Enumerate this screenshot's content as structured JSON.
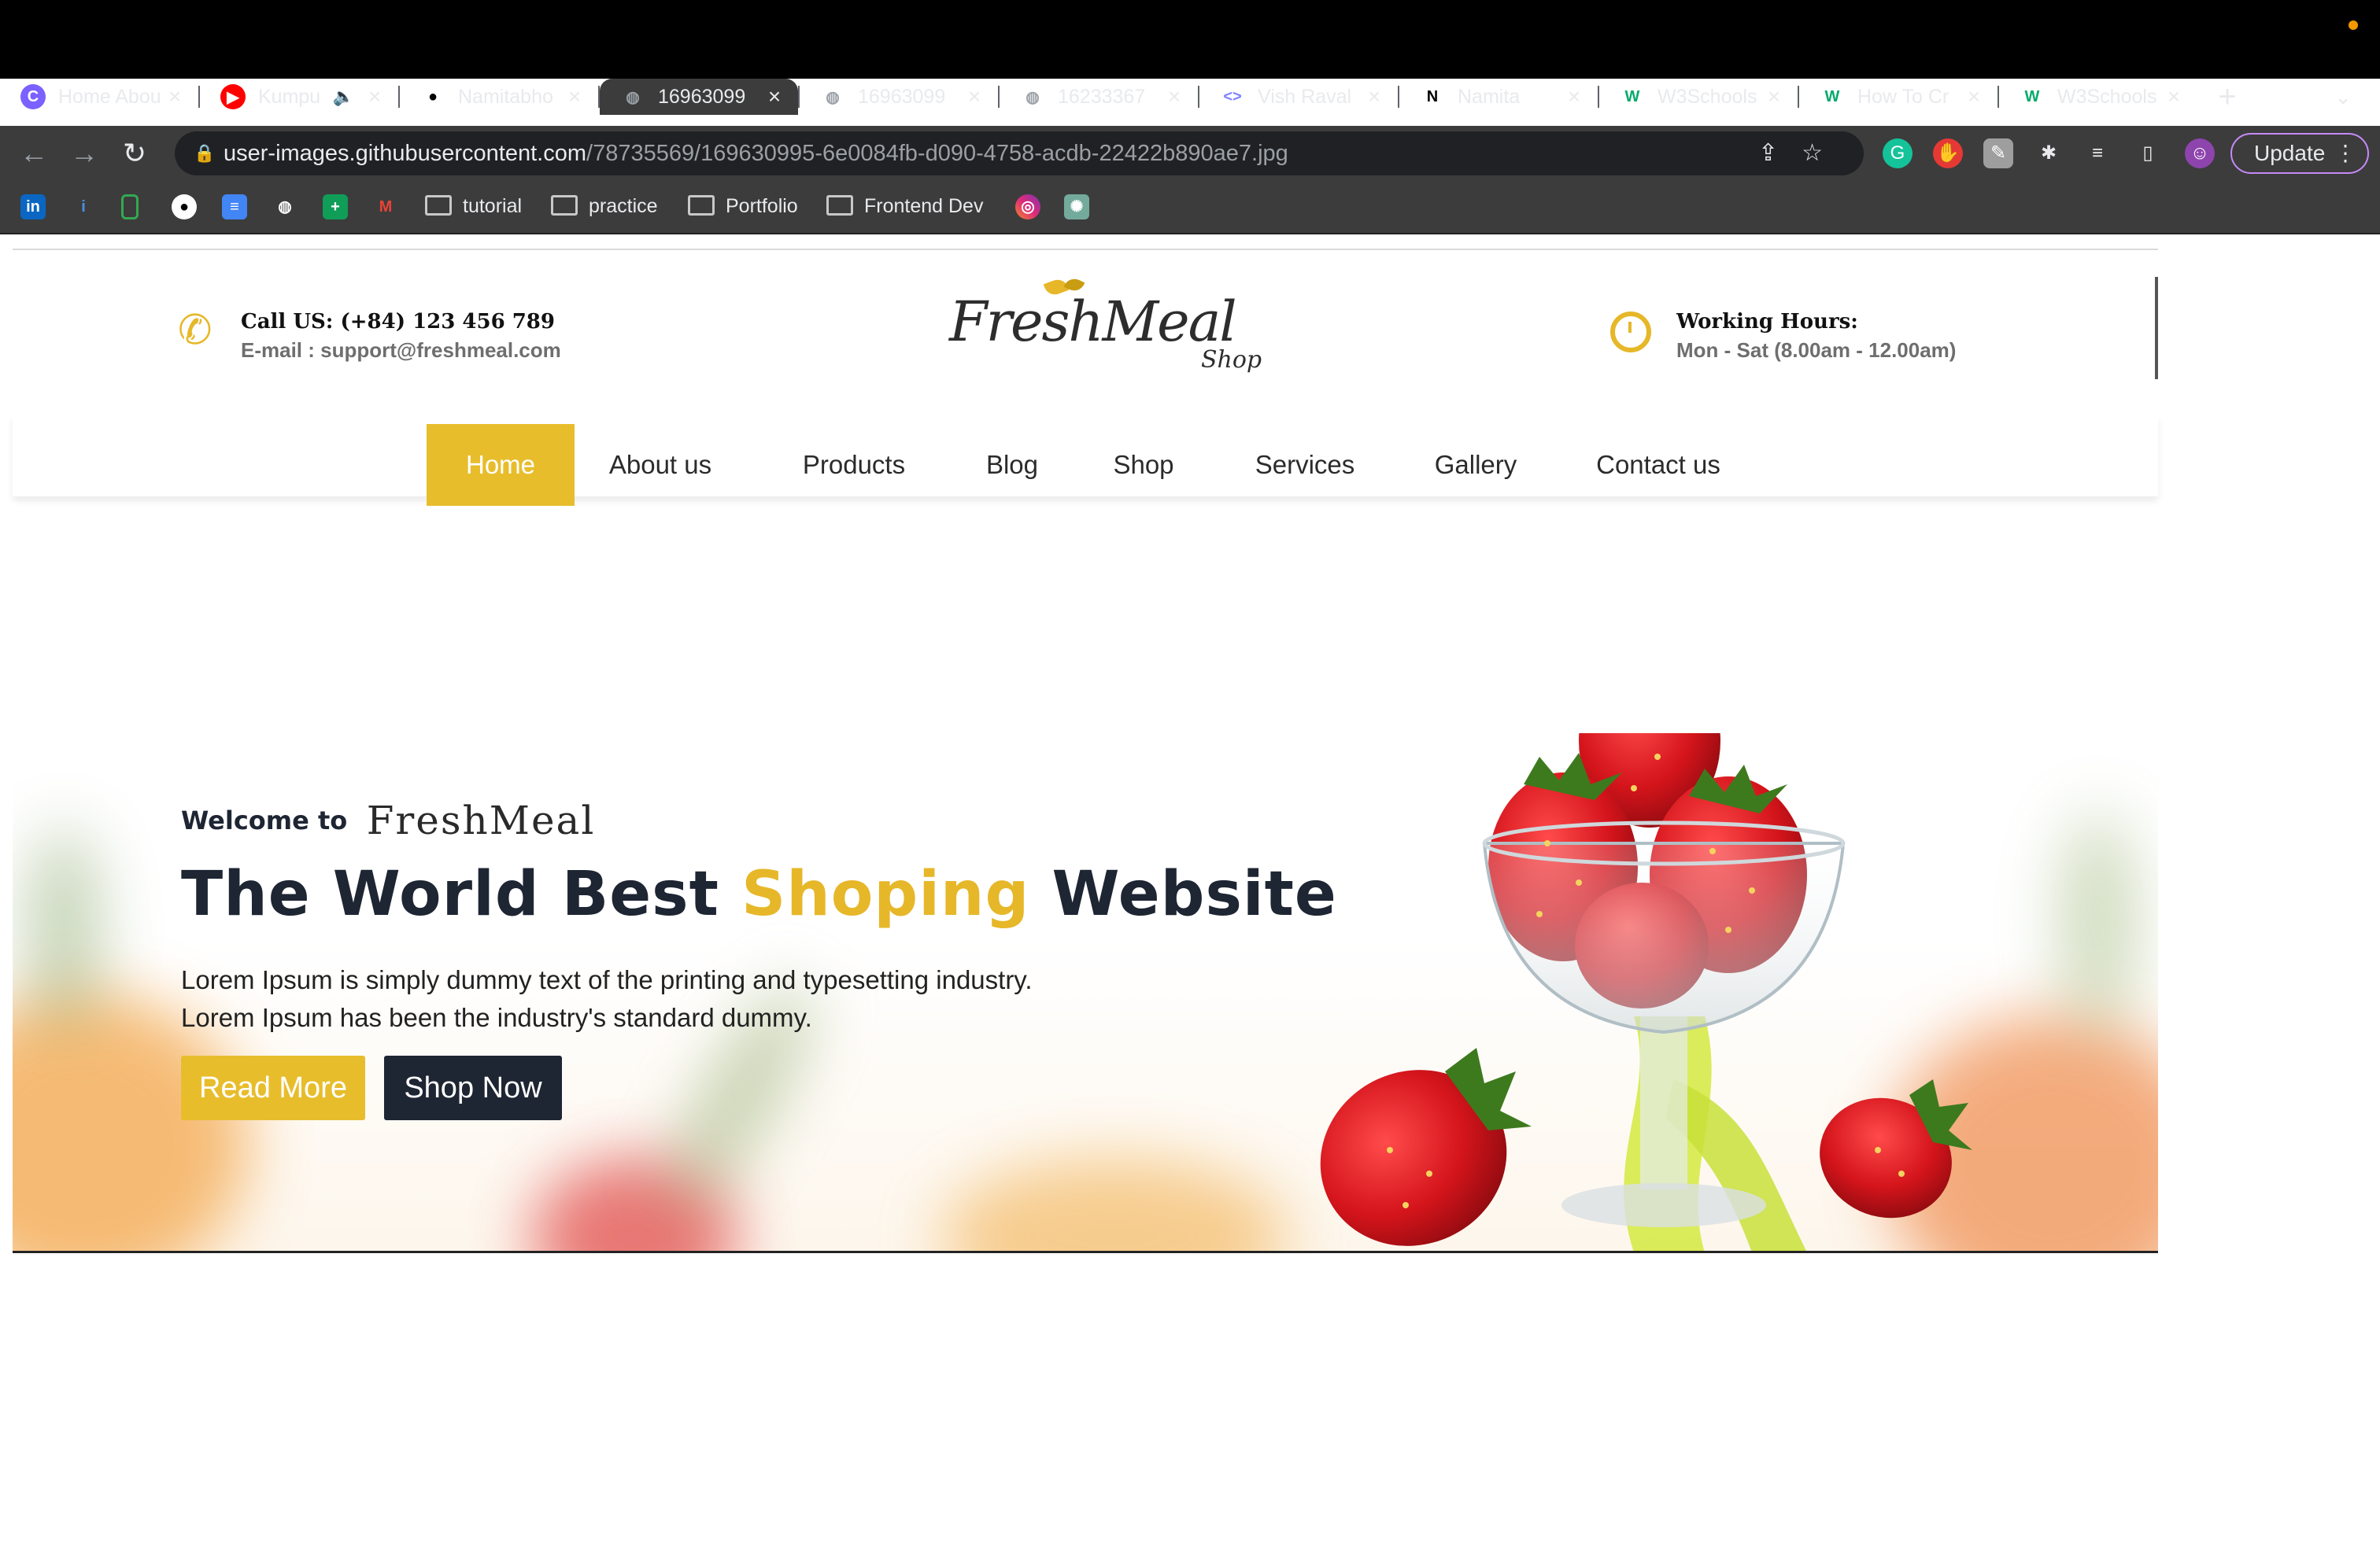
{
  "browser": {
    "tabs": [
      {
        "title": "Home Abou",
        "favicon": "edge-circle-icon",
        "color": "#7b61ff"
      },
      {
        "title": "Kumpu",
        "favicon": "youtube-icon",
        "color": "#ff0000",
        "audio": true
      },
      {
        "title": "Namitabho",
        "favicon": "github-icon",
        "color": "#ffffff"
      },
      {
        "title": "16963099",
        "favicon": "globe-icon",
        "color": "#9aa0a6",
        "active": true
      },
      {
        "title": "16963099",
        "favicon": "globe-icon",
        "color": "#9aa0a6"
      },
      {
        "title": "16233367",
        "favicon": "globe-icon",
        "color": "#9aa0a6"
      },
      {
        "title": "Vish Raval",
        "favicon": "code-icon",
        "color": "#7c83ff"
      },
      {
        "title": "Namita",
        "favicon": "notion-icon",
        "color": "#ffffff"
      },
      {
        "title": "W3Schools",
        "favicon": "w3schools-icon",
        "color": "#04aa6d"
      },
      {
        "title": "How To Cr",
        "favicon": "w3schools-icon",
        "color": "#04aa6d"
      },
      {
        "title": "W3Schools",
        "favicon": "w3schools-icon",
        "color": "#04aa6d"
      }
    ],
    "url_host": "user-images.githubusercontent.com",
    "url_path": "/78735569/169630995-6e0084fb-d090-4758-acdb-22422b890ae7.jpg",
    "update_label": "Update",
    "bookmarks": [
      "tutorial",
      "practice",
      "Portfolio",
      "Frontend Dev"
    ]
  },
  "site": {
    "call_us": "Call US: (+84) 123 456 789",
    "email": "E-mail : support@freshmeal.com",
    "logo_main": "FreshMeal",
    "logo_sub": "Shop",
    "hours_title": "Working Hours:",
    "hours_value": "Mon - Sat (8.00am - 12.00am)",
    "menu": [
      "Home",
      "About us",
      "Products",
      "Blog",
      "Shop",
      "Services",
      "Gallery",
      "Contact us"
    ],
    "active_menu": "Home",
    "accent_color": "#e8bd2c",
    "dark_color": "#1e2533"
  },
  "hero": {
    "welcome": "Welcome to",
    "brand": "FreshMeal",
    "headline_pre": "The World Best ",
    "headline_accent": "Shoping",
    "headline_post": " Website",
    "lead_line1": "Lorem Ipsum is simply dummy text of the printing and typesetting industry.",
    "lead_line2": "Lorem Ipsum has been the industry's standard dummy.",
    "read_more": "Read More",
    "shop_now": "Shop Now"
  }
}
